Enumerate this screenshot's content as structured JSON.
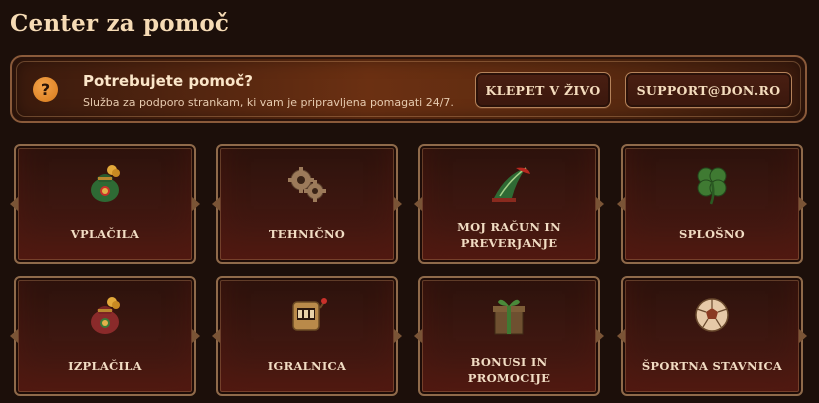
{
  "page": {
    "title": "Center za pomoč"
  },
  "help_banner": {
    "icon": "question-mark-icon",
    "icon_glyph": "?",
    "heading": "Potrebujete pomoč?",
    "subtext": "Služba za podporo strankam, ki vam je pripravljena pomagati 24/7.",
    "chat_button": "KLEPET V ŽIVO",
    "email_button": "SUPPORT@DON.RO"
  },
  "categories": [
    {
      "label": "VPLAČILA",
      "icon": "money-bag-icon"
    },
    {
      "label": "TEHNIČNO",
      "icon": "gears-icon"
    },
    {
      "label_line1": "MOJ RAČUN IN",
      "label_line2": "PREVERJANJE",
      "icon": "feathered-hat-icon"
    },
    {
      "label": "SPLOŠNO",
      "icon": "four-leaf-clover-icon"
    },
    {
      "label": "IZPLAČILA",
      "icon": "money-bag-icon"
    },
    {
      "label": "IGRALNICA",
      "icon": "slot-machine-icon"
    },
    {
      "label_line1": "BONUSI IN",
      "label_line2": "PROMOCIJE",
      "icon": "gift-box-icon"
    },
    {
      "label": "ŠPORTNA STAVNICA",
      "icon": "football-icon"
    }
  ],
  "colors": {
    "background": "#1c0f0a",
    "accent_orange": "#e08a2a",
    "text_cream": "#f3dcc0",
    "frame_bronze": "#8f6a4a"
  }
}
